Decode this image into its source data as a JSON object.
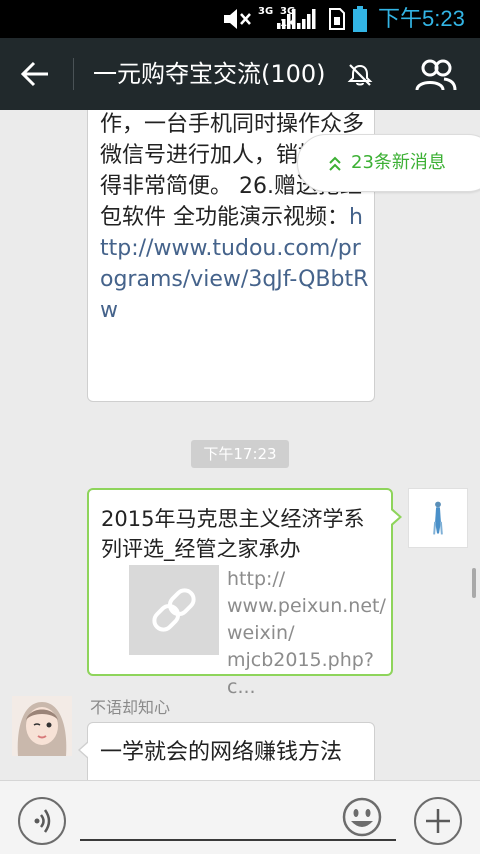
{
  "status_bar": {
    "time": "下午5:23",
    "net_1_top": "3G",
    "net_1_bottom": "",
    "net_2_top": "3G",
    "net_2_bottom": "1X",
    "icons": [
      "mute-icon",
      "signal-icon",
      "signal-icon",
      "sim-icon",
      "battery-icon"
    ]
  },
  "header": {
    "title": "一元购夺宝交流(100)",
    "icons": [
      "back-arrow-icon",
      "notifications-off-icon",
      "group-members-icon"
    ]
  },
  "new_messages_pill": {
    "label": "23条新消息",
    "icon": "double-chevron-up-icon",
    "accent_color": "#3cb034"
  },
  "messages": [
    {
      "type": "text",
      "text_before_link": "作，一台手机同时操作众多微信号进行加人，销推广变得非常简便。 26.赠送抢红包软件  全功能演示视频：",
      "link": "http://www.tudou.com/programs/view/3qJf-QBbtRw"
    },
    {
      "type": "timestamp",
      "text": "下午17:23"
    },
    {
      "type": "link_share",
      "title": "2015年马克思主义经济学系列评选_经管之家承办",
      "url": "http://\nwww.peixun.net/\nweixin/\nmjcb2015.php?c...",
      "thumb_icon": "link-icon",
      "border_color": "#8ed45b"
    },
    {
      "type": "text",
      "sender": "不语却知心",
      "text": "一学就会的网络赚钱方法"
    }
  ],
  "input_bar": {
    "icons": [
      "voice-icon",
      "emoji-icon",
      "plus-icon"
    ]
  }
}
